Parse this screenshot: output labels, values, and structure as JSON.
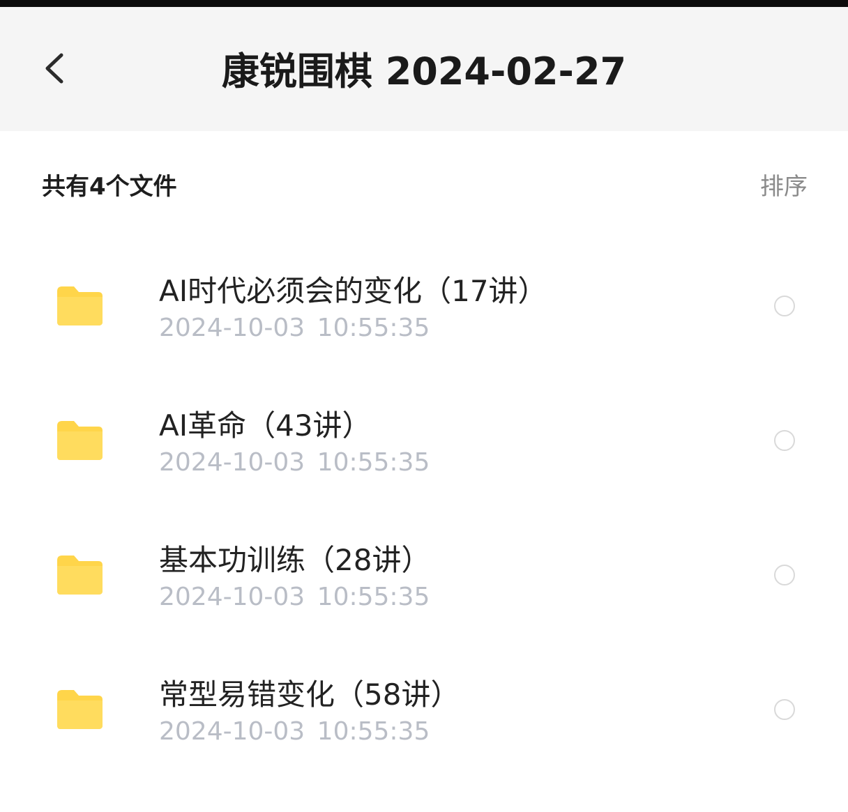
{
  "header": {
    "title": "康锐围棋 2024-02-27",
    "back_icon": "chevron-left-icon"
  },
  "summary": {
    "count_text": "共有4个文件",
    "sort_label": "排序"
  },
  "folders": [
    {
      "name": "AI时代必须会的变化（17讲）",
      "date": "2024-10-03 10:55:35",
      "icon": "folder-icon"
    },
    {
      "name": "AI革命（43讲）",
      "date": "2024-10-03 10:55:35",
      "icon": "folder-icon"
    },
    {
      "name": "基本功训练（28讲）",
      "date": "2024-10-03 10:55:35",
      "icon": "folder-icon"
    },
    {
      "name": "常型易错变化（58讲）",
      "date": "2024-10-03 10:55:35",
      "icon": "folder-icon"
    }
  ],
  "colors": {
    "folder": "#ffd54a",
    "header_bg": "#f5f5f5",
    "date_text": "#b9bdc6",
    "sort_text": "#8a8a8a"
  }
}
